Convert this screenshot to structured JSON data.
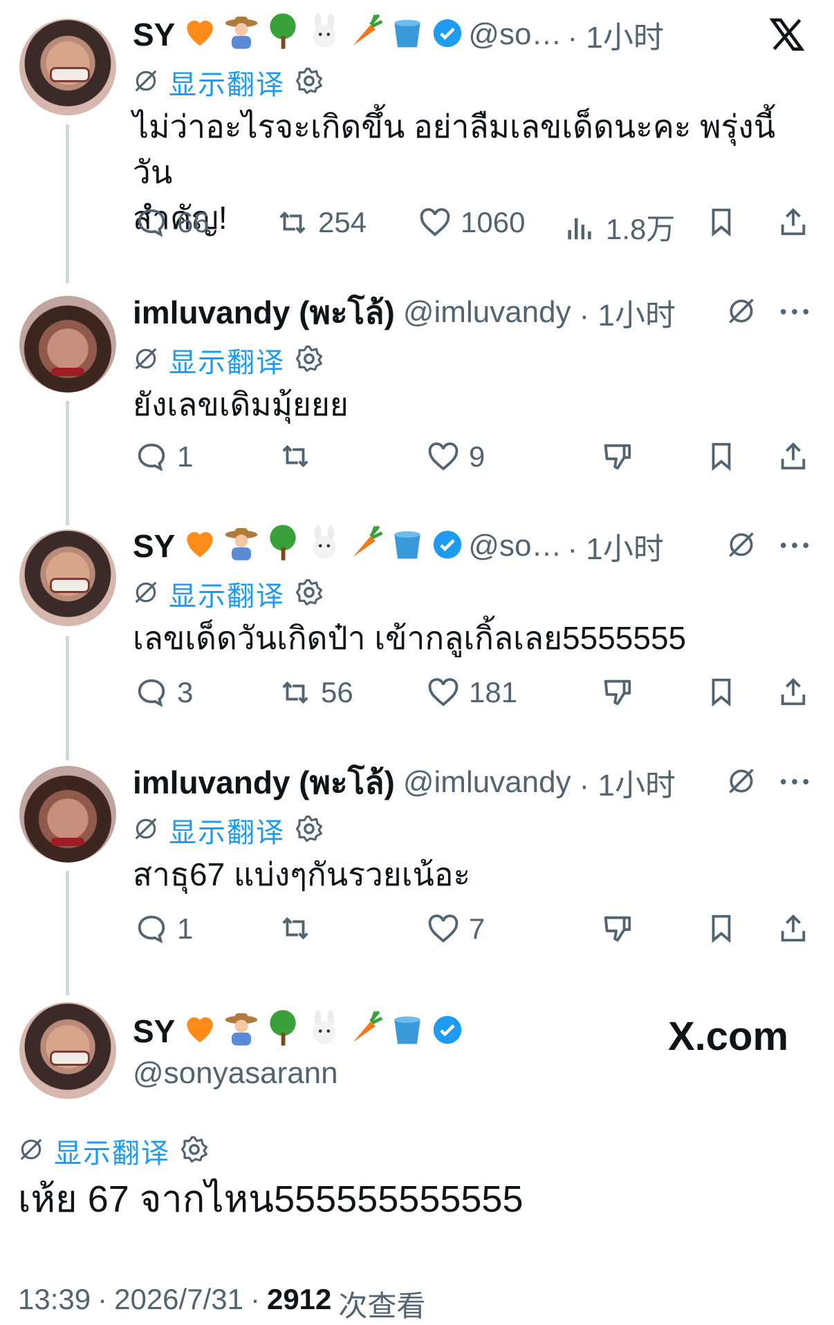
{
  "colors": {
    "text": "#0f1419",
    "muted": "#536471",
    "accent": "#1d9bf0",
    "thread": "#cfd9de"
  },
  "emoji_names": [
    "orange-heart-icon",
    "farmer-icon",
    "tree-icon",
    "rabbit-icon",
    "carrot-icon",
    "bucket-icon"
  ],
  "tweets": [
    {
      "name": "SY",
      "handle": "@so…",
      "time": "· 1小时",
      "translate": "显示翻译",
      "text_lines": [
        "ไม่ว่าอะไรจะเกิดขึ้น อย่าลืมเลขเด็ดนะคะ พรุ่งนี้วัน",
        "สำคัญ!"
      ],
      "replies": "66",
      "retweets": "254",
      "likes": "1060",
      "views": "1.8万"
    },
    {
      "name": "imluvandy (พะโล้)",
      "handle": "@imluvandy",
      "time": "· 1小时",
      "translate": "显示翻译",
      "text": "ยังเลขเดิมมุ้ยยย",
      "replies": "1",
      "likes": "9"
    },
    {
      "name": "SY",
      "handle": "@so…",
      "time": "· 1小时",
      "translate": "显示翻译",
      "text": "เลขเด็ดวันเกิดป๋า เข้ากลูเกิ้ลเลย5555555",
      "replies": "3",
      "retweets": "56",
      "likes": "181"
    },
    {
      "name": "imluvandy (พะโล้)",
      "handle": "@imluvandy",
      "time": "· 1小时",
      "translate": "显示翻译",
      "text": "สาธุ67 แบ่งๆกันรวยเน้อะ",
      "replies": "1",
      "likes": "7"
    }
  ],
  "main": {
    "name": "SY",
    "handle": "@sonyasarann",
    "translate": "显示翻译",
    "text": "เห้ย 67 จากไหน555555555555",
    "time": "13:39",
    "date": "2026/7/31",
    "views_count": "2912",
    "views_label": "次查看",
    "brand": "X.com"
  }
}
